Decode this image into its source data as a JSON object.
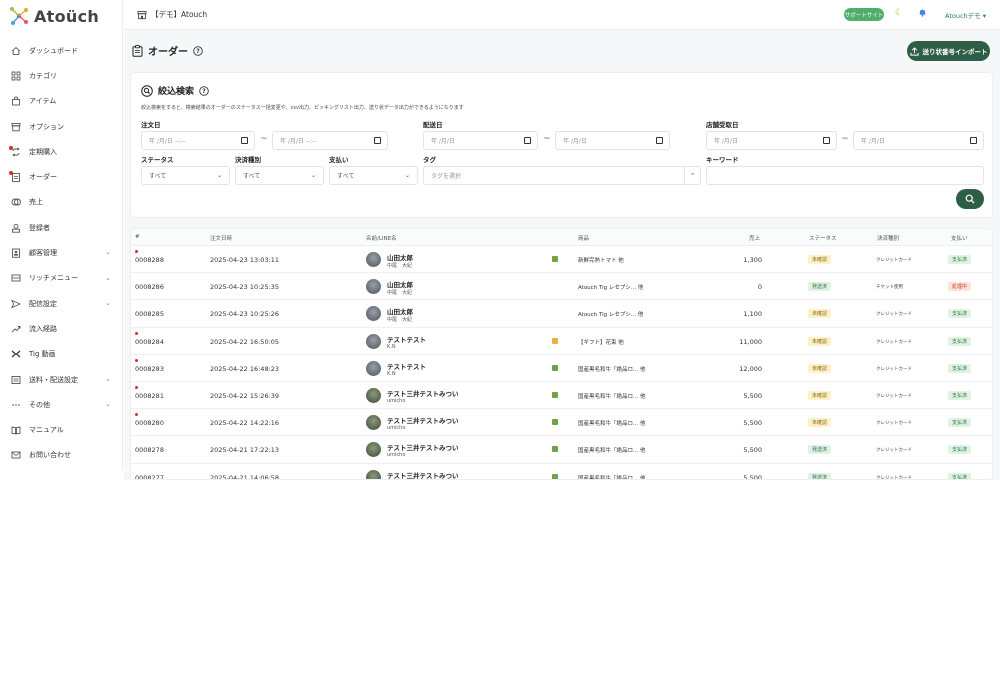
{
  "brand": {
    "name": "Atoüch",
    "accent": "#2f5e46"
  },
  "sidebar": {
    "items": [
      {
        "label": "ダッシュボード",
        "icon": "home-icon",
        "dot": false,
        "chevron": false
      },
      {
        "label": "カテゴリ",
        "icon": "grid-icon",
        "dot": false,
        "chevron": false
      },
      {
        "label": "アイテム",
        "icon": "bag-icon",
        "dot": false,
        "chevron": false
      },
      {
        "label": "オプション",
        "icon": "box-icon",
        "dot": false,
        "chevron": false
      },
      {
        "label": "定期購入",
        "icon": "repeat-icon",
        "dot": true,
        "chevron": false
      },
      {
        "label": "オーダー",
        "icon": "clipboard-icon",
        "dot": true,
        "chevron": false
      },
      {
        "label": "売上",
        "icon": "coins-icon",
        "dot": false,
        "chevron": false
      },
      {
        "label": "登録者",
        "icon": "user-icon",
        "dot": false,
        "chevron": false
      },
      {
        "label": "顧客管理",
        "icon": "customer-icon",
        "dot": false,
        "chevron": true
      },
      {
        "label": "リッチメニュー",
        "icon": "menu-icon",
        "dot": false,
        "chevron": true
      },
      {
        "label": "配信設定",
        "icon": "send-icon",
        "dot": false,
        "chevron": true
      },
      {
        "label": "流入経路",
        "icon": "trend-icon",
        "dot": false,
        "chevron": false
      },
      {
        "label": "Tig 動画",
        "icon": "video-icon",
        "dot": false,
        "chevron": false
      },
      {
        "label": "送料・配送設定",
        "icon": "truck-icon",
        "dot": false,
        "chevron": true
      },
      {
        "label": "その他",
        "icon": "more-icon",
        "dot": false,
        "chevron": true
      },
      {
        "label": "マニュアル",
        "icon": "book-icon",
        "dot": false,
        "chevron": false
      },
      {
        "label": "お問い合わせ",
        "icon": "mail-icon",
        "dot": false,
        "chevron": false
      }
    ]
  },
  "topbar": {
    "shop_name": "【デモ】Atouch",
    "support_label": "サポートサイト",
    "user_label": "Atouchデモ ▾"
  },
  "page": {
    "title": "オーダー",
    "import_label": "送り状番号インポート"
  },
  "filter": {
    "title": "絞込検索",
    "description": "絞込検索をすると、検索結果のオーダーのステータス一括変更や、csv出力、ピッキングリスト出力、送り状データ出力ができるようになります",
    "order_date_label": "注文日",
    "delivery_date_label": "配送日",
    "pickup_date_label": "店舗受取日",
    "datetime_placeholder": "年 /月/日 --:--",
    "date_placeholder": "年 /月/日",
    "tilde": "~",
    "status_label": "ステータス",
    "payment_type_label": "決済種別",
    "payment_label": "支払い",
    "tag_label": "タグ",
    "keyword_label": "キーワード",
    "status_value": "すべて",
    "payment_type_value": "すべて",
    "payment_value": "すべて",
    "tag_placeholder": "タグを選択"
  },
  "table": {
    "headers": [
      "#",
      "注文日時",
      "名前/LINE名",
      "商品",
      "売上",
      "ステータス",
      "決済種別",
      "支払い"
    ],
    "rows": [
      {
        "id": "0008288",
        "date": "2025-04-23 13:03:11",
        "name": "山田太郎",
        "sub": "中尾　大紀",
        "avatar": "a",
        "dot": true,
        "tag": "g",
        "product": "新鮮完熟トマト 他",
        "sales": "1,300",
        "status": "未確認",
        "status_type": "unconf",
        "method": "クレジットカード",
        "pay": "支払済",
        "pay_type": "paid"
      },
      {
        "id": "0008286",
        "date": "2025-04-23 10:25:35",
        "name": "山田太郎",
        "sub": "中尾　大紀",
        "avatar": "a",
        "dot": false,
        "tag": "",
        "product": "Atouch Tig レセプシ... 他",
        "sales": "0",
        "status": "発送済",
        "status_type": "sent",
        "method": "チケット使用",
        "pay": "処理中",
        "pay_type": "proc"
      },
      {
        "id": "0008285",
        "date": "2025-04-23 10:25:26",
        "name": "山田太郎",
        "sub": "中尾　大紀",
        "avatar": "a",
        "dot": false,
        "tag": "",
        "product": "Atouch Tig レセプシ... 他",
        "sales": "1,100",
        "status": "未確認",
        "status_type": "unconf",
        "method": "クレジットカード",
        "pay": "支払済",
        "pay_type": "paid"
      },
      {
        "id": "0008284",
        "date": "2025-04-22 16:50:05",
        "name": "テストテスト",
        "sub": "K.N",
        "avatar": "a",
        "dot": true,
        "tag": "y",
        "product": "【ギフト】花束 他",
        "sales": "11,000",
        "status": "未確認",
        "status_type": "unconf",
        "method": "クレジットカード",
        "pay": "支払済",
        "pay_type": "paid"
      },
      {
        "id": "0008283",
        "date": "2025-04-22 16:48:23",
        "name": "テストテスト",
        "sub": "K.N",
        "avatar": "a",
        "dot": true,
        "tag": "g",
        "product": "国産黒毛和牛「絶品ロ... 他",
        "sales": "12,000",
        "status": "未確認",
        "status_type": "unconf",
        "method": "クレジットカード",
        "pay": "支払済",
        "pay_type": "paid"
      },
      {
        "id": "0008281",
        "date": "2025-04-22 15:26:39",
        "name": "テスト三井テストみつい",
        "sub": "umicho",
        "avatar": "b",
        "dot": true,
        "tag": "g",
        "product": "国産黒毛和牛「絶品ロ... 他",
        "sales": "5,500",
        "status": "未確認",
        "status_type": "unconf",
        "method": "クレジットカード",
        "pay": "支払済",
        "pay_type": "paid"
      },
      {
        "id": "0008280",
        "date": "2025-04-22 14:22:16",
        "name": "テスト三井テストみつい",
        "sub": "umicho",
        "avatar": "b",
        "dot": true,
        "tag": "g",
        "product": "国産黒毛和牛「絶品ロ... 他",
        "sales": "5,500",
        "status": "未確認",
        "status_type": "unconf",
        "method": "クレジットカード",
        "pay": "支払済",
        "pay_type": "paid"
      },
      {
        "id": "0008278",
        "date": "2025-04-21 17:22:13",
        "name": "テスト三井テストみつい",
        "sub": "umicho",
        "avatar": "b",
        "dot": false,
        "tag": "g",
        "product": "国産黒毛和牛「絶品ロ... 他",
        "sales": "5,500",
        "status": "発送済",
        "status_type": "sent",
        "method": "クレジットカード",
        "pay": "支払済",
        "pay_type": "paid"
      },
      {
        "id": "0008277",
        "date": "2025-04-21 14:06:58",
        "name": "テスト三井テストみつい",
        "sub": "umicho",
        "avatar": "b",
        "dot": false,
        "tag": "g",
        "product": "国産黒毛和牛「絶品ロ... 他",
        "sales": "5,500",
        "status": "発送済",
        "status_type": "sent",
        "method": "クレジットカード",
        "pay": "支払済",
        "pay_type": "paid"
      }
    ]
  }
}
